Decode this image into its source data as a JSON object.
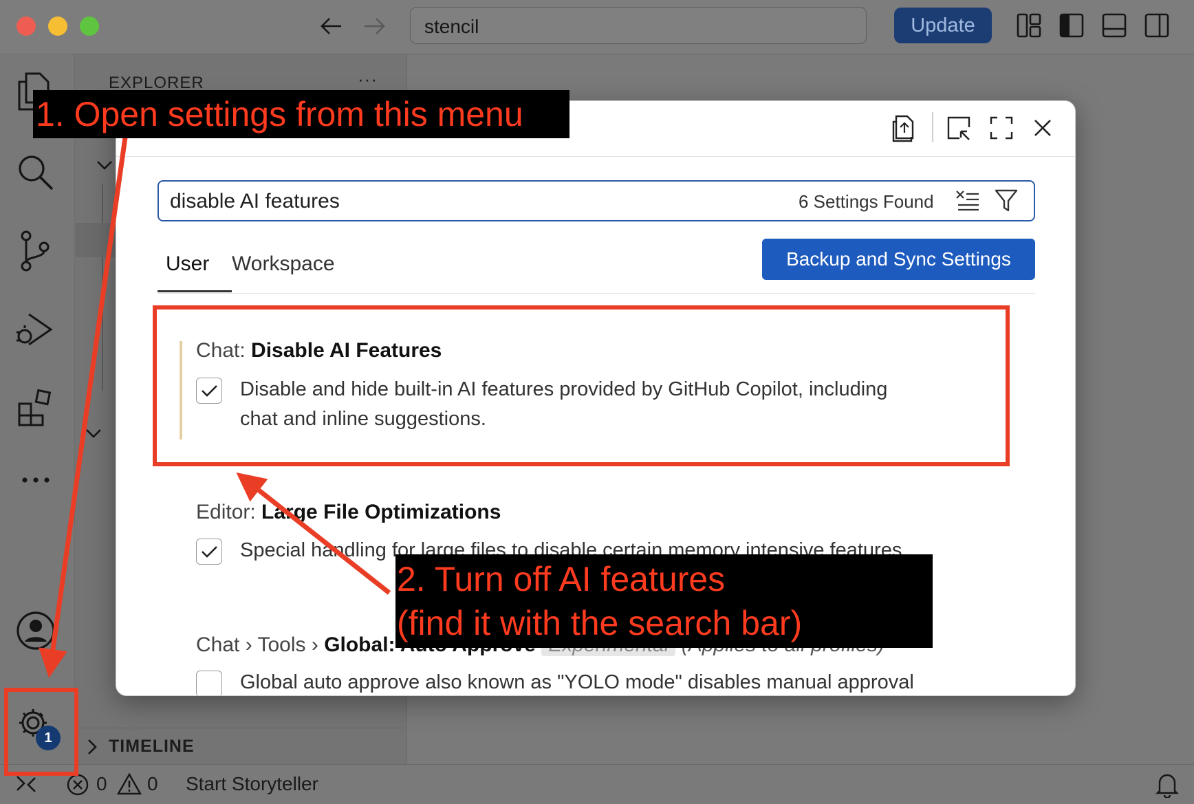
{
  "titlebar": {
    "search_text": "stencil",
    "update_label": "Update",
    "traffic_light_colors": [
      "#ef5d52",
      "#f6be33",
      "#5fc43f"
    ],
    "icons": [
      "back-arrow-icon",
      "forward-arrow-icon",
      "customize-layout-icon",
      "toggle-primary-sidebar-icon",
      "toggle-panel-icon",
      "toggle-secondary-sidebar-icon"
    ]
  },
  "activity_bar": {
    "icons": [
      "explorer-icon",
      "search-icon",
      "source-control-icon",
      "run-debug-icon",
      "extensions-icon",
      "more-icon",
      "accounts-icon",
      "manage-gear-icon"
    ],
    "gear_badge": "1"
  },
  "sidebar": {
    "explorer_title": "EXPLORER",
    "more_label": "···",
    "timeline_label": "TIMELINE"
  },
  "statusbar": {
    "errors": "0",
    "warnings": "0",
    "storyteller": "Start Storyteller"
  },
  "settings_dialog": {
    "search": {
      "value": "disable AI features",
      "results": "6 Settings Found"
    },
    "tabs": [
      {
        "label": "User",
        "active": true
      },
      {
        "label": "Workspace",
        "active": false
      }
    ],
    "sync_button": "Backup and Sync Settings",
    "settings": [
      {
        "category": "Chat: ",
        "name": "Disable AI Features",
        "checked": true,
        "description": "Disable and hide built-in AI features provided by GitHub Copilot, including chat and inline suggestions."
      },
      {
        "category": "Editor: ",
        "name": "Large File Optimizations",
        "checked": true,
        "description": "Special handling for large files to disable certain memory intensive features."
      },
      {
        "category": "Chat › Tools › ",
        "name": "Global: Auto Approve",
        "tag": "Experimental",
        "note": "(Applies to all profiles)",
        "checked": false,
        "description": "Global auto approve also known as \"YOLO mode\" disables manual approval"
      }
    ]
  },
  "annotations": {
    "step1": "1. Open settings from this menu",
    "step2_line1": "2. Turn off AI features",
    "step2_line2": "(find it with the search bar)",
    "annotation_color": "#ea3d26"
  }
}
